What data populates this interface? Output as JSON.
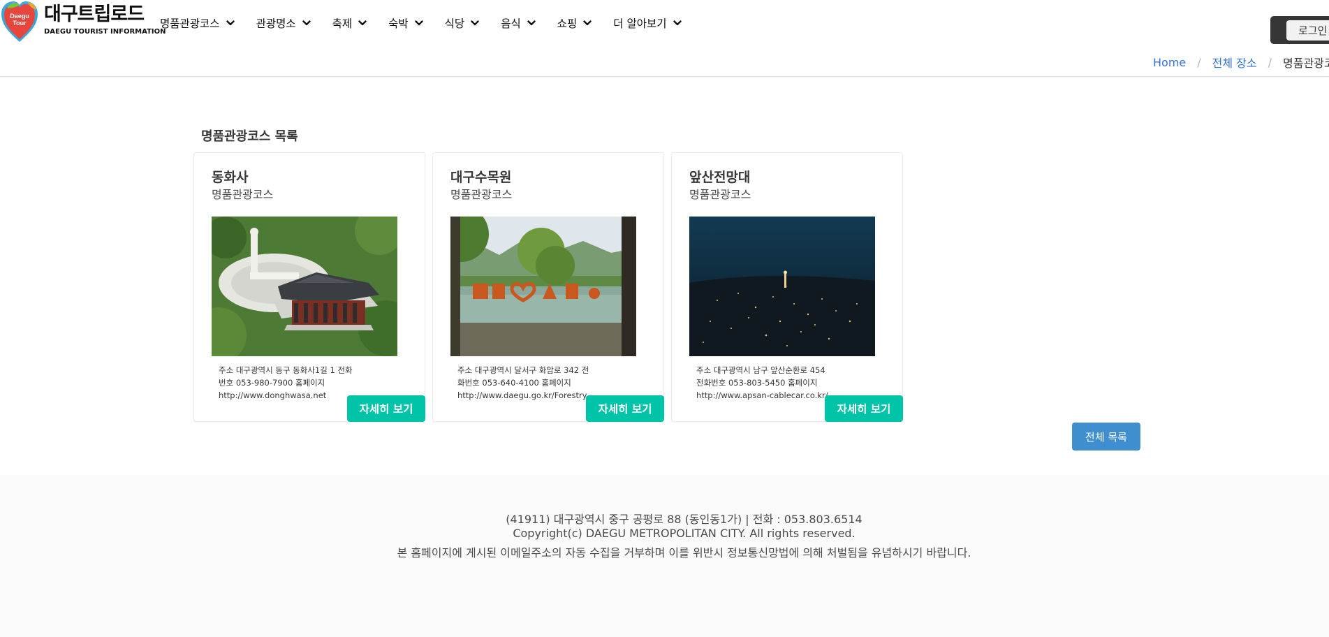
{
  "brand": {
    "title": "대구트립로드",
    "subtitle": "DAEGU TOURIST INFORMATION",
    "badge_line1": "Daegu",
    "badge_line2": "Tour"
  },
  "nav": {
    "items": [
      {
        "label": "명품관광코스"
      },
      {
        "label": "관광명소"
      },
      {
        "label": "축제"
      },
      {
        "label": "숙박"
      },
      {
        "label": "식당"
      },
      {
        "label": "음식"
      },
      {
        "label": "쇼핑"
      },
      {
        "label": "더 알아보기"
      }
    ]
  },
  "header": {
    "login_label": "로그인"
  },
  "breadcrumb": {
    "home": "Home",
    "all": "전체 장소",
    "current": "명품관광코스"
  },
  "main": {
    "section_title": "명품관광코스 목록",
    "cards": [
      {
        "name": "동화사",
        "category": "명품관광코스",
        "address": "주소 대구광역시 동구 동화사1길 1 전화",
        "phone": "번호 053-980-7900 홈페이지",
        "website": "http://www.donghwasa.net",
        "button": "자세히 보기"
      },
      {
        "name": "대구수목원",
        "category": "명품관광코스",
        "address": "주소 대구광역시 달서구 화암로 342 전",
        "phone": "화번호 053-640-4100 홈페이지",
        "website": "http://www.daegu.go.kr/Forestry",
        "button": "자세히 보기"
      },
      {
        "name": "앞산전망대",
        "category": "명품관광코스",
        "address": "주소 대구광역시 남구 앞산순환로 454",
        "phone": "전화번호 053-803-5450 홈페이지",
        "website": "http://www.apsan-cablecar.co.kr/",
        "button": "자세히 보기"
      }
    ],
    "all_list_button": "전체 목록"
  },
  "footer": {
    "address_line": "(41911) 대구광역시 중구 공평로 88 (동인동1가) | 전화 : 053.803.6514",
    "copyright_line": "Copyright(c) DAEGU METROPOLITAN CITY. All rights reserved.",
    "notice_line": "본 홈페이지에 게시된 이메일주소의 자동 수집을 거부하며 이를 위반시 정보통신망법에 의해 처벌됨을 유념하시기 바랍니다."
  },
  "colors": {
    "primary_teal": "#00c4a7",
    "info_blue": "#3e8ed0",
    "link_blue": "#3273dc",
    "dark": "#363636"
  },
  "icons": {
    "nav_dropdown": "chevron-down-icon",
    "logo": "heart-logo-icon"
  }
}
